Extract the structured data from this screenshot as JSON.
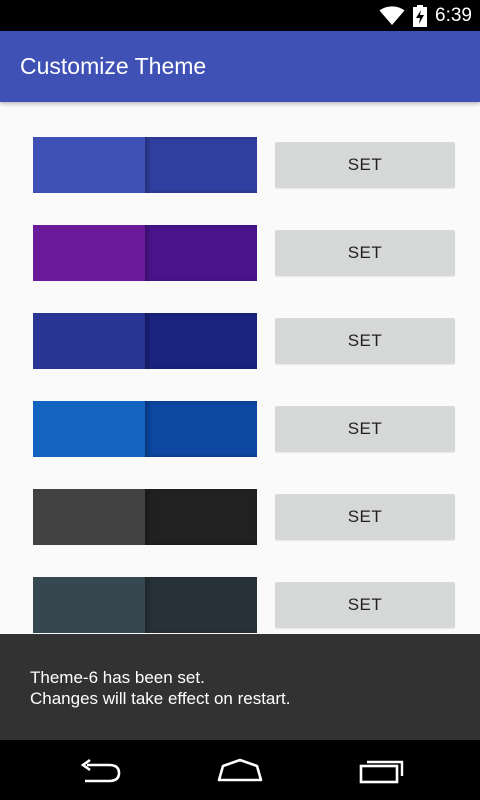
{
  "status_bar": {
    "time": "6:39",
    "battery_level": "charging",
    "wifi_icon": "wifi-icon",
    "battery_icon": "battery-charging-icon"
  },
  "app_bar": {
    "title": "Customize Theme"
  },
  "themes": [
    {
      "primary": "#3f51b5",
      "dark": "#303f9f",
      "button_label": "SET"
    },
    {
      "primary": "#6a1b9a",
      "dark": "#4a148c",
      "button_label": "SET"
    },
    {
      "primary": "#283593",
      "dark": "#1a237e",
      "button_label": "SET"
    },
    {
      "primary": "#1565c0",
      "dark": "#0d47a1",
      "button_label": "SET"
    },
    {
      "primary": "#424242",
      "dark": "#212121",
      "button_label": "SET"
    },
    {
      "primary": "#37474f",
      "dark": "#263238",
      "button_label": "SET"
    }
  ],
  "snackbar": {
    "line1": "Theme-6 has been set.",
    "line2": "Changes will take effect on restart."
  },
  "nav_bar": {
    "back_icon": "back-icon",
    "home_icon": "home-icon",
    "recents_icon": "recents-icon"
  }
}
